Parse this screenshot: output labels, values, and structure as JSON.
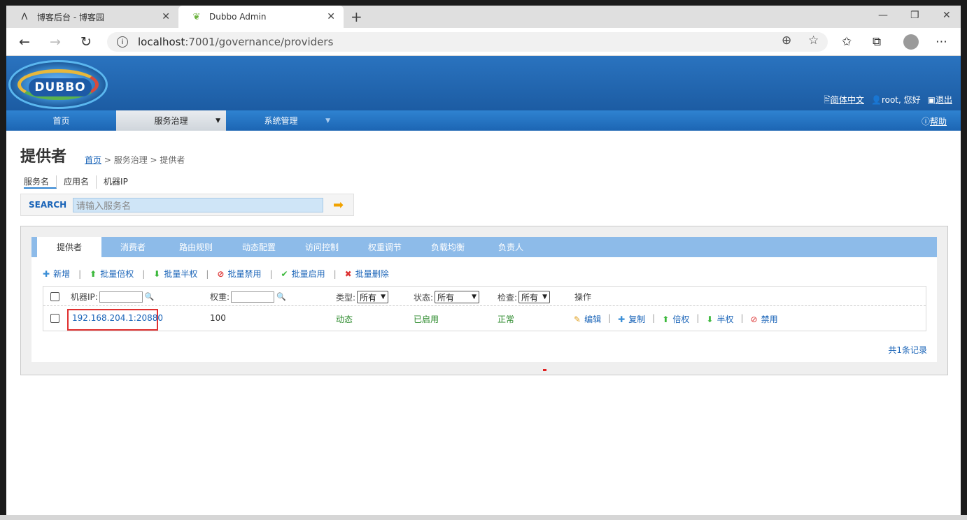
{
  "browser": {
    "tabs": [
      {
        "title": "博客后台 - 博客园",
        "icon": "cnblogs-icon"
      },
      {
        "title": "Dubbo Admin",
        "icon": "spring-leaf-icon"
      }
    ],
    "url_host": "localhost",
    "url_path": ":7001/governance/providers"
  },
  "header": {
    "logo_text": "DUBBO",
    "lang_label": "简体中文",
    "user_label": "root, 您好",
    "logout_label": "退出"
  },
  "nav": {
    "items": [
      {
        "label": "首页"
      },
      {
        "label": "服务治理"
      },
      {
        "label": "系统管理"
      }
    ],
    "help_label": "帮助"
  },
  "page": {
    "title": "提供者",
    "breadcrumb_home": "首页",
    "breadcrumb_rest": " > 服务治理 > 提供者",
    "search_types": [
      "服务名",
      "应用名",
      "机器IP"
    ],
    "search_label": "SEARCH",
    "search_placeholder": "请输入服务名"
  },
  "panel": {
    "tabs": [
      "提供者",
      "消费者",
      "路由规则",
      "动态配置",
      "访问控制",
      "权重调节",
      "负载均衡",
      "负责人"
    ],
    "actions": [
      {
        "icon": "plus-icon",
        "label": "新增"
      },
      {
        "icon": "arrow-up-icon",
        "label": "批量倍权"
      },
      {
        "icon": "arrow-down-icon",
        "label": "批量半权"
      },
      {
        "icon": "ban-icon",
        "label": "批量禁用"
      },
      {
        "icon": "check-icon",
        "label": "批量启用"
      },
      {
        "icon": "x-icon",
        "label": "批量删除"
      }
    ],
    "table": {
      "headers": {
        "ip": "机器IP:",
        "weight": "权重:",
        "type": "类型:",
        "type_value": "所有",
        "status": "状态:",
        "status_value": "所有",
        "check": "检查:",
        "check_value": "所有",
        "ops": "操作"
      },
      "rows": [
        {
          "ip": "192.168.204.1:20880",
          "weight": "100",
          "type": "动态",
          "status": "已启用",
          "check": "正常",
          "ops": [
            "编辑",
            "复制",
            "倍权",
            "半权",
            "禁用"
          ]
        }
      ]
    },
    "total": "共1条记录"
  }
}
